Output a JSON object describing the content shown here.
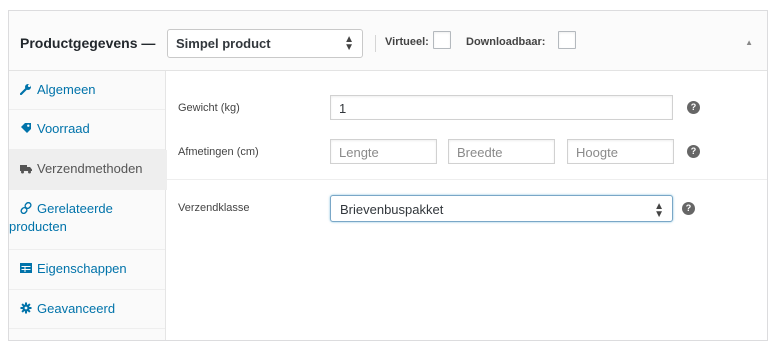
{
  "header": {
    "title": "Productgegevens —",
    "product_type": {
      "selected": "Simpel product"
    },
    "virtual_label": "Virtueel:",
    "downloadable_label": "Downloadbaar:"
  },
  "sidebar": {
    "items": [
      {
        "label": "Algemeen",
        "icon": "wrench-icon"
      },
      {
        "label": "Voorraad",
        "icon": "tag-icon"
      },
      {
        "label": "Verzendmethoden",
        "icon": "truck-icon",
        "active": true
      },
      {
        "label": "Gerelateerde",
        "label2": "producten",
        "icon": "link-icon"
      },
      {
        "label": "Eigenschappen",
        "icon": "table-icon"
      },
      {
        "label": "Geavanceerd",
        "icon": "gear-icon"
      }
    ]
  },
  "shipping": {
    "weight": {
      "label": "Gewicht (kg)",
      "value": "1"
    },
    "dimensions": {
      "label": "Afmetingen (cm)",
      "length_placeholder": "Lengte",
      "width_placeholder": "Breedte",
      "height_placeholder": "Hoogte"
    },
    "shipping_class": {
      "label": "Verzendklasse",
      "selected": "Brievenbuspakket"
    }
  },
  "colors": {
    "link": "#0073aa",
    "active_tab_bg": "#eeeeee",
    "help_icon": "#666666"
  }
}
